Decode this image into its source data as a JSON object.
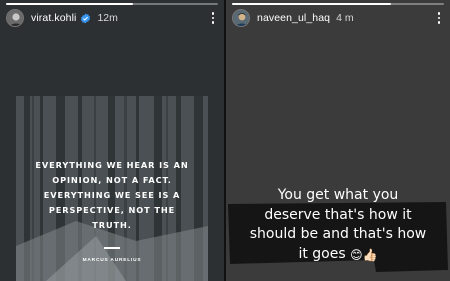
{
  "left_story": {
    "username": "virat.kohli",
    "time": "12m",
    "progress": 0.6,
    "quote_lines": [
      "EVERYTHING WE HEAR IS AN",
      "OPINION, NOT A FACT.",
      "EVERYTHING WE SEE IS A",
      "PERSPECTIVE, NOT THE",
      "TRUTH."
    ],
    "quote_author": "MARCUS AURELIUS"
  },
  "right_story": {
    "username": "naveen_ul_haq",
    "time": "4 m",
    "progress": 0.75,
    "caption_lines": [
      "You get what you",
      "deserve that's how it",
      "should be and that's how",
      "it goes"
    ],
    "caption_emojis": "😊👍🏻"
  },
  "icons": {
    "verified": "verified-badge-icon",
    "menu": "more-options-icon"
  },
  "colors": {
    "verified": "#3897f0",
    "left_bg": "#2c3033",
    "right_bg": "#3b3b3b"
  }
}
